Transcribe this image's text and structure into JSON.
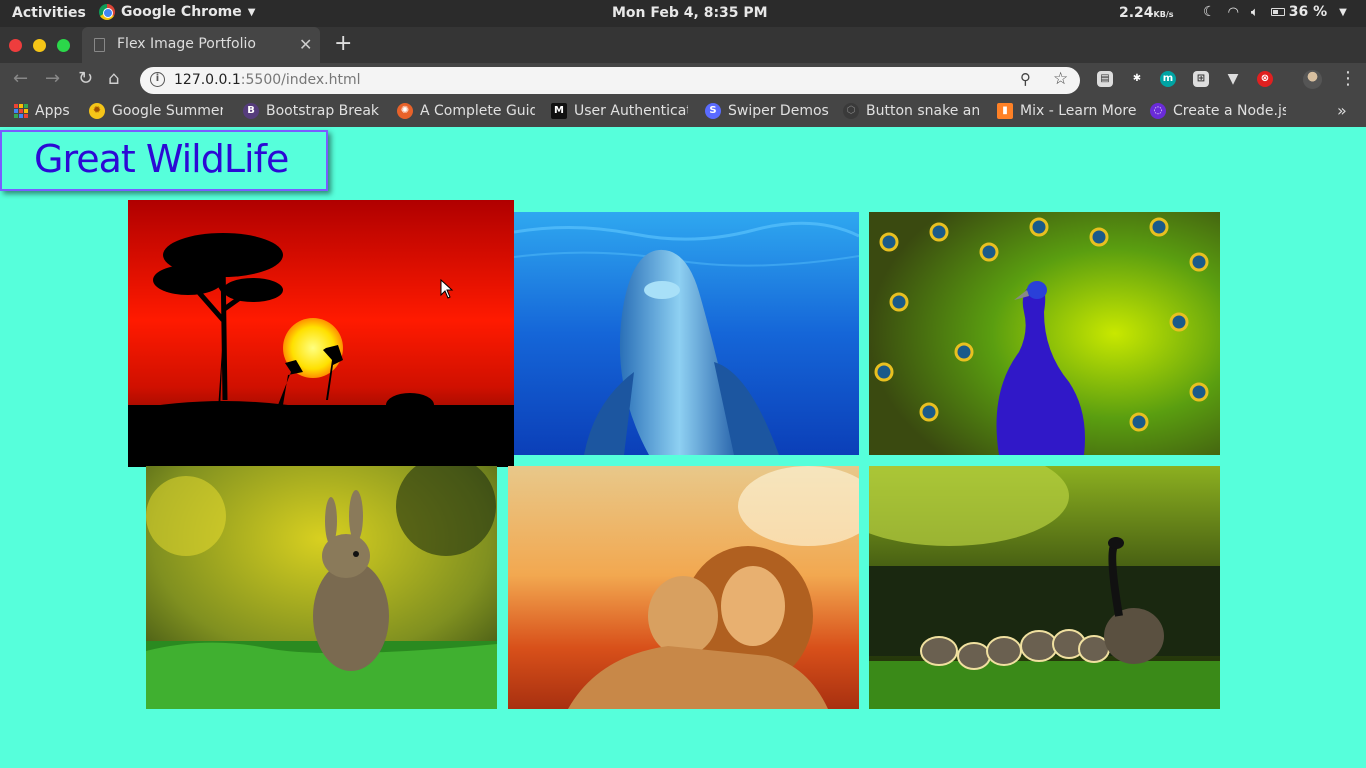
{
  "system_bar": {
    "activities": "Activities",
    "app_name": "Google Chrome",
    "clock": "Mon Feb  4,  8:35 PM",
    "net_speed": "2.24",
    "net_unit": "KB/s",
    "battery": "36 %"
  },
  "browser": {
    "tab_title": "Flex Image Portfolio",
    "url_host": "127.0.0.1",
    "url_rest": ":5500/index.html",
    "bookmarks": [
      {
        "label": "Apps"
      },
      {
        "label": "Google Summer"
      },
      {
        "label": "Bootstrap Break"
      },
      {
        "label": "A Complete Guid"
      },
      {
        "label": "User Authenticat"
      },
      {
        "label": "Swiper Demos"
      },
      {
        "label": "Button snake an"
      },
      {
        "label": "Mix - Learn More"
      },
      {
        "label": "Create a Node.js"
      }
    ]
  },
  "page": {
    "heading": "Great WildLife",
    "gallery": [
      {
        "subject": "savanna-sunset"
      },
      {
        "subject": "dolphin"
      },
      {
        "subject": "peacock"
      },
      {
        "subject": "rabbit"
      },
      {
        "subject": "lions"
      },
      {
        "subject": "geese"
      }
    ]
  },
  "colors": {
    "page_bg": "#56ffdb",
    "heading_text": "#2c0ad4",
    "heading_border": "#7a5cff"
  }
}
